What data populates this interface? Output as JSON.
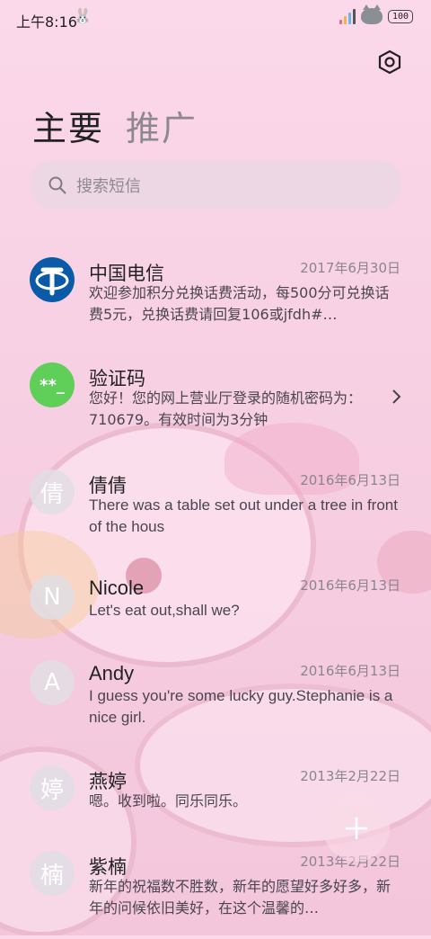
{
  "status_bar": {
    "time": "上午8:16",
    "battery": "100",
    "icons": [
      "sticker-icon",
      "signal-icon",
      "cat-sticker-icon",
      "battery-icon"
    ]
  },
  "header": {
    "tabs": [
      {
        "label": "主要",
        "active": true
      },
      {
        "label": "推广",
        "active": false
      }
    ],
    "settings_icon": "settings-hexagon-icon"
  },
  "search": {
    "placeholder": "搜索短信"
  },
  "messages": [
    {
      "name": "中国电信",
      "date": "2017年6月30日",
      "preview": "欢迎参加积分兑换话费活动，每500分可兑换话费5元，兑换话费请回复106或jfdh#…",
      "avatar_text": "",
      "avatar_icon": "china-telecom-logo"
    },
    {
      "name": "验证码",
      "date": "",
      "preview": "您好！您的网上营业厅登录的随机密码为：710679。有效时间为3分钟",
      "avatar_text": "**_",
      "avatar_icon": "verification-code-icon"
    },
    {
      "name": "倩倩",
      "date": "2016年6月13日",
      "preview": "There was a table set out under a tree in front of the hous",
      "avatar_text": "倩"
    },
    {
      "name": "Nicole",
      "date": "2016年6月13日",
      "preview": "Let's eat out,shall we?",
      "avatar_text": "N"
    },
    {
      "name": "Andy",
      "date": "2016年6月13日",
      "preview": "I guess you're some lucky guy.Stephanie is a nice girl.",
      "avatar_text": "A"
    },
    {
      "name": "燕婷",
      "date": "2013年2月22日",
      "preview": "嗯。收到啦。同乐同乐。",
      "avatar_text": "婷"
    },
    {
      "name": "紫楠",
      "date": "2013年2月22日",
      "preview": "新年的祝福数不胜数，新年的愿望好多好多，新年的问候依旧美好，在这个温馨的…",
      "avatar_text": "楠"
    }
  ],
  "fab": {
    "icon": "plus-icon"
  },
  "colors": {
    "background": "#f7cfe2",
    "verification_avatar": "#5fcf5a",
    "telecom_blue": "#0a5aa8"
  }
}
